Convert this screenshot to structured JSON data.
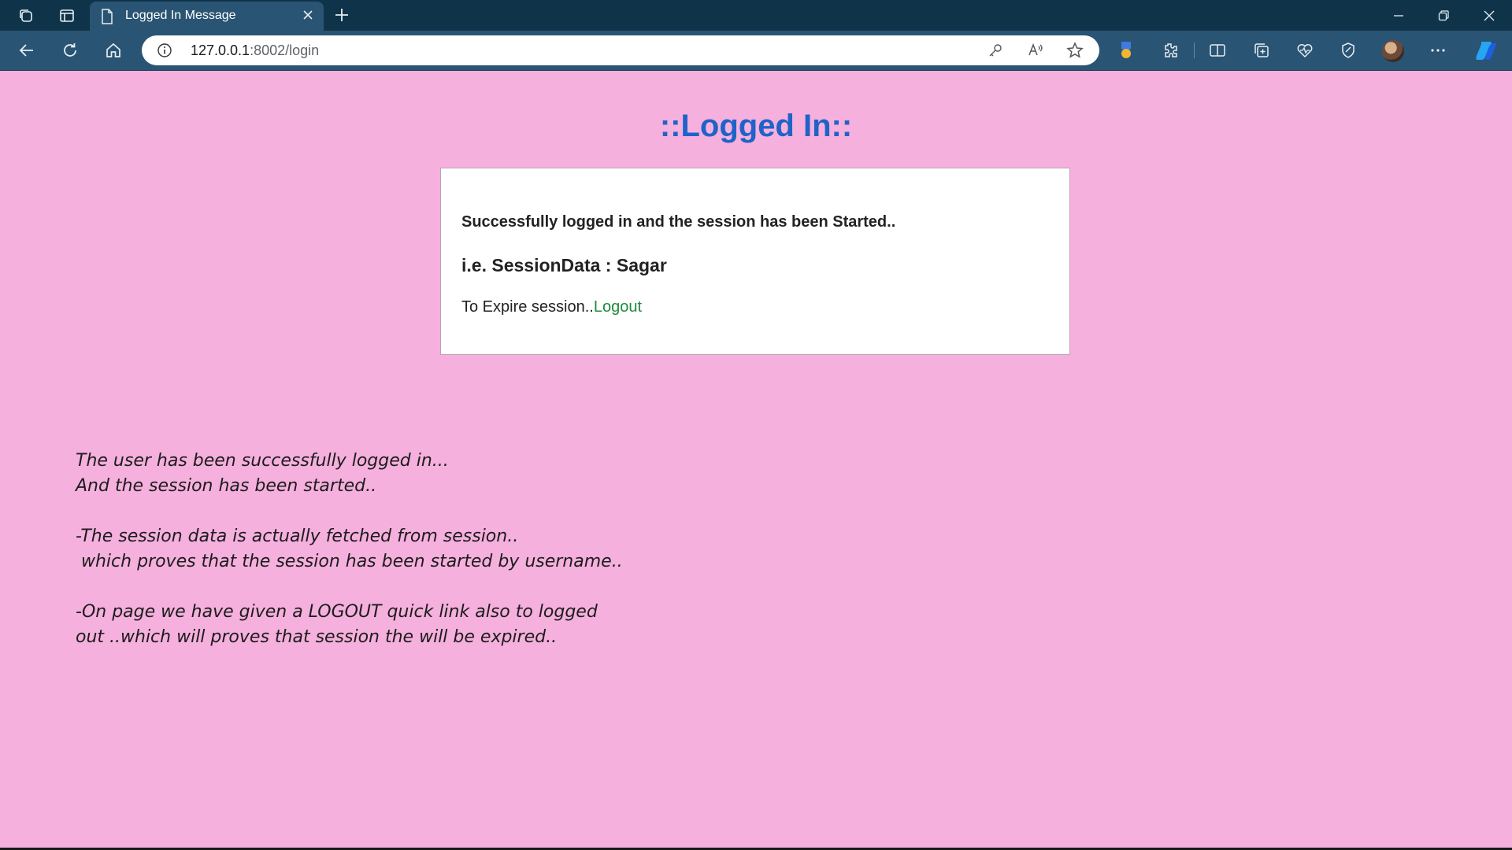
{
  "browser": {
    "tab_title": "Logged In Message",
    "url_host": "127.0.0.1",
    "url_rest": ":8002/login"
  },
  "page": {
    "heading": "::Logged In::",
    "card": {
      "success_text": "Successfully logged in and the session has been Started..",
      "session_line": "i.e. SessionData : Sagar",
      "expire_prefix": "To Expire session..",
      "logout_link": "Logout"
    },
    "notes": [
      "The user has been successfully logged in...",
      "And the session has been started..",
      "",
      "-The session data is actually fetched from session..",
      " which proves that the session has been started by username..",
      "",
      "-On page we have given a LOGOUT quick link also to logged",
      "out ..which will proves that session the will be expired.."
    ]
  },
  "colors": {
    "page_background": "#f5b0dd",
    "heading": "#1f63c9",
    "link": "#1e8a3c",
    "browser_frame": "#0f3449"
  }
}
